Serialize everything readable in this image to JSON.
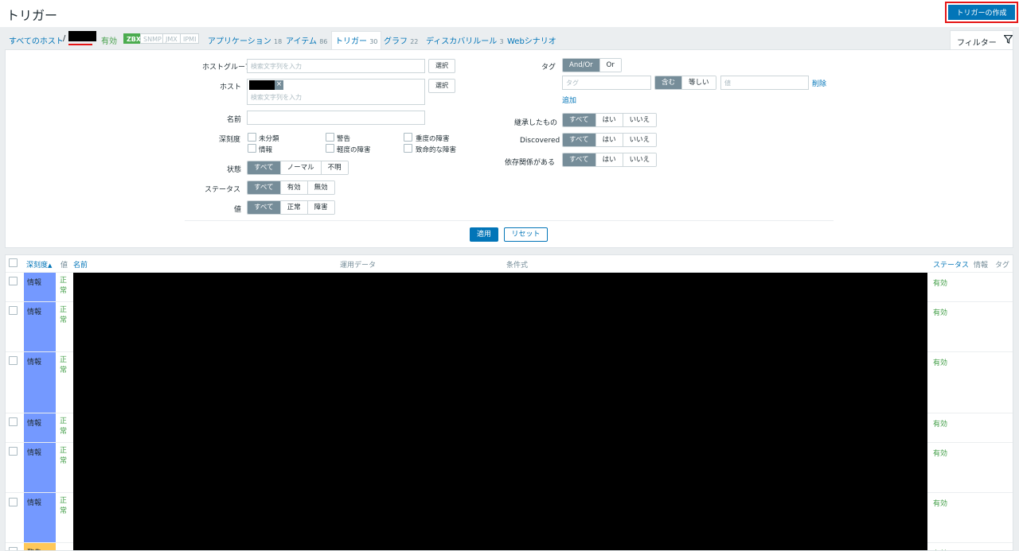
{
  "header": {
    "title": "トリガー",
    "create_button": "トリガーの作成"
  },
  "nav": {
    "all_hosts": "すべてのホスト",
    "separator": "/",
    "enabled": "有効",
    "tags": [
      "ZBX",
      "SNMP",
      "JMX",
      "IPMI"
    ],
    "items": [
      {
        "label": "アプリケーション",
        "count": "18"
      },
      {
        "label": "アイテム",
        "count": "86"
      },
      {
        "label": "トリガー",
        "count": "30"
      },
      {
        "label": "グラフ",
        "count": "22"
      },
      {
        "label": "ディスカバリルール",
        "count": "3"
      },
      {
        "label": "Webシナリオ",
        "count": ""
      }
    ],
    "filter_tab": "フィルター"
  },
  "filter": {
    "hostgroup_label": "ホストグループ",
    "hostgroup_placeholder": "検索文字列を入力",
    "select_button": "選択",
    "host_label": "ホスト",
    "host_placeholder": "検索文字列を入力",
    "host_chip_close": "×",
    "name_label": "名前",
    "severity_label": "深刻度",
    "severities": [
      "未分類",
      "警告",
      "重度の障害",
      "情報",
      "軽度の障害",
      "致命的な障害"
    ],
    "state_label": "状態",
    "state_options": [
      "すべて",
      "ノーマル",
      "不明"
    ],
    "status_label": "ステータス",
    "status_options": [
      "すべて",
      "有効",
      "無効"
    ],
    "value_label": "値",
    "value_options": [
      "すべて",
      "正常",
      "障害"
    ],
    "tag_label": "タグ",
    "tag_ops": [
      "And/Or",
      "Or"
    ],
    "tag_placeholder": "タグ",
    "tag_match": [
      "含む",
      "等しい"
    ],
    "tag_value_placeholder": "値",
    "tag_remove": "削除",
    "tag_add": "追加",
    "inherited_label": "継承したもの",
    "discovered_label": "Discovered",
    "dependencies_label": "依存関係がある",
    "yesno_options": [
      "すべて",
      "はい",
      "いいえ"
    ],
    "apply": "適用",
    "reset": "リセット"
  },
  "table": {
    "columns": {
      "severity": "深刻度",
      "sort_arrow": "▲",
      "value": "値",
      "name": "名前",
      "operational_data": "運用データ",
      "expression": "条件式",
      "status": "ステータス",
      "info": "情報",
      "tags": "タグ"
    },
    "rows": [
      {
        "severity": "情報",
        "value": "正常",
        "status": "有効"
      },
      {
        "severity": "情報",
        "value": "正常",
        "status": "有効"
      },
      {
        "severity": "情報",
        "value": "正常",
        "status": "有効"
      },
      {
        "severity": "情報",
        "value": "正常",
        "status": "有効"
      },
      {
        "severity": "情報",
        "value": "正常",
        "status": "有効"
      },
      {
        "severity": "情報",
        "value": "正常",
        "status": "有効"
      },
      {
        "severity": "警告",
        "value": "",
        "status": "有効"
      }
    ]
  }
}
